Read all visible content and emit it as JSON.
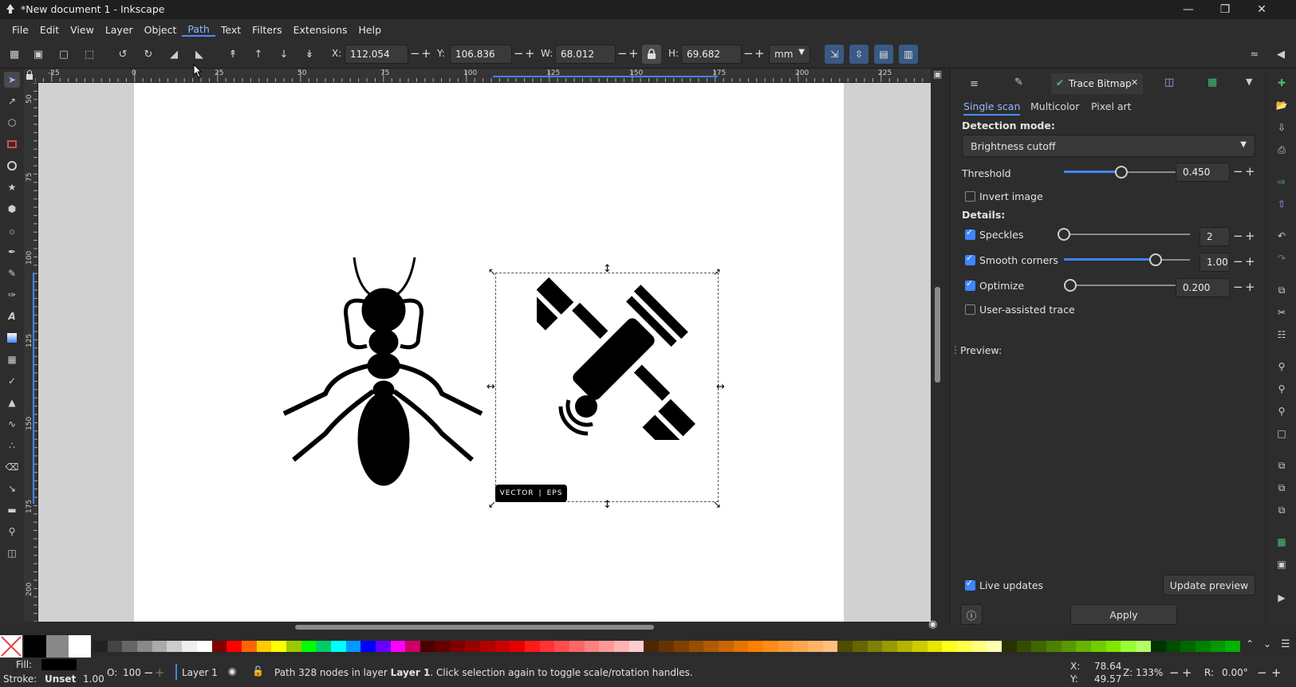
{
  "window": {
    "title": "*New document 1 - Inkscape"
  },
  "menu": [
    "File",
    "Edit",
    "View",
    "Layer",
    "Object",
    "Path",
    "Text",
    "Filters",
    "Extensions",
    "Help"
  ],
  "menu_active": "Path",
  "toolbar": {
    "x_label": "X:",
    "x_value": "112.054",
    "y_label": "Y:",
    "y_value": "106.836",
    "w_label": "W:",
    "w_value": "68.012",
    "h_label": "H:",
    "h_value": "69.682",
    "unit": "mm"
  },
  "ruler": {
    "h_labels": [
      "-25",
      "0",
      "25",
      "50",
      "75",
      "100",
      "125",
      "150",
      "175",
      "200",
      "225"
    ],
    "v_labels": [
      "50",
      "75",
      "100",
      "125",
      "150",
      "175",
      "200"
    ]
  },
  "canvas": {
    "watermark_left": "VECTOR",
    "watermark_right": "EPS"
  },
  "panel": {
    "tab_label": "Trace Bitmap",
    "subtabs": [
      "Single scan",
      "Multicolor",
      "Pixel art"
    ],
    "detection_mode_label": "Detection mode:",
    "detection_mode_value": "Brightness cutoff",
    "threshold_label": "Threshold",
    "threshold_value": "0.450",
    "threshold_fraction": 0.45,
    "invert_label": "Invert image",
    "details_label": "Details:",
    "speckles_label": "Speckles",
    "speckles_value": "2",
    "speckles_fraction": 0.0,
    "smooth_label": "Smooth corners",
    "smooth_value": "1.00",
    "smooth_fraction": 0.75,
    "optimize_label": "Optimize",
    "optimize_value": "0.200",
    "optimize_fraction": 0.0,
    "user_assisted_label": "User-assisted trace",
    "preview_label": "Preview:",
    "live_updates_label": "Live updates",
    "update_preview_label": "Update preview",
    "apply_label": "Apply"
  },
  "status": {
    "fill_label": "Fill:",
    "stroke_label": "Stroke:",
    "stroke_value": "Unset",
    "stroke_width": "1.00",
    "opacity_label": "O:",
    "opacity_value": "100",
    "layer_name": "Layer 1",
    "message_pre": "Path 328 nodes in layer ",
    "message_layer": "Layer 1",
    "message_post": ". Click selection again to toggle scale/rotation handles.",
    "x_readout_label": "X:",
    "x_readout": "78.64",
    "y_readout_label": "Y:",
    "y_readout": "49.57",
    "zoom_label": "Z:",
    "zoom_value": "133%",
    "rotation_label": "R:",
    "rotation_value": "0.00°"
  },
  "colors": {
    "accent": "#3d86ff",
    "panel_bg": "#2d2d2d",
    "canvas_bg": "#d1d1d1"
  }
}
